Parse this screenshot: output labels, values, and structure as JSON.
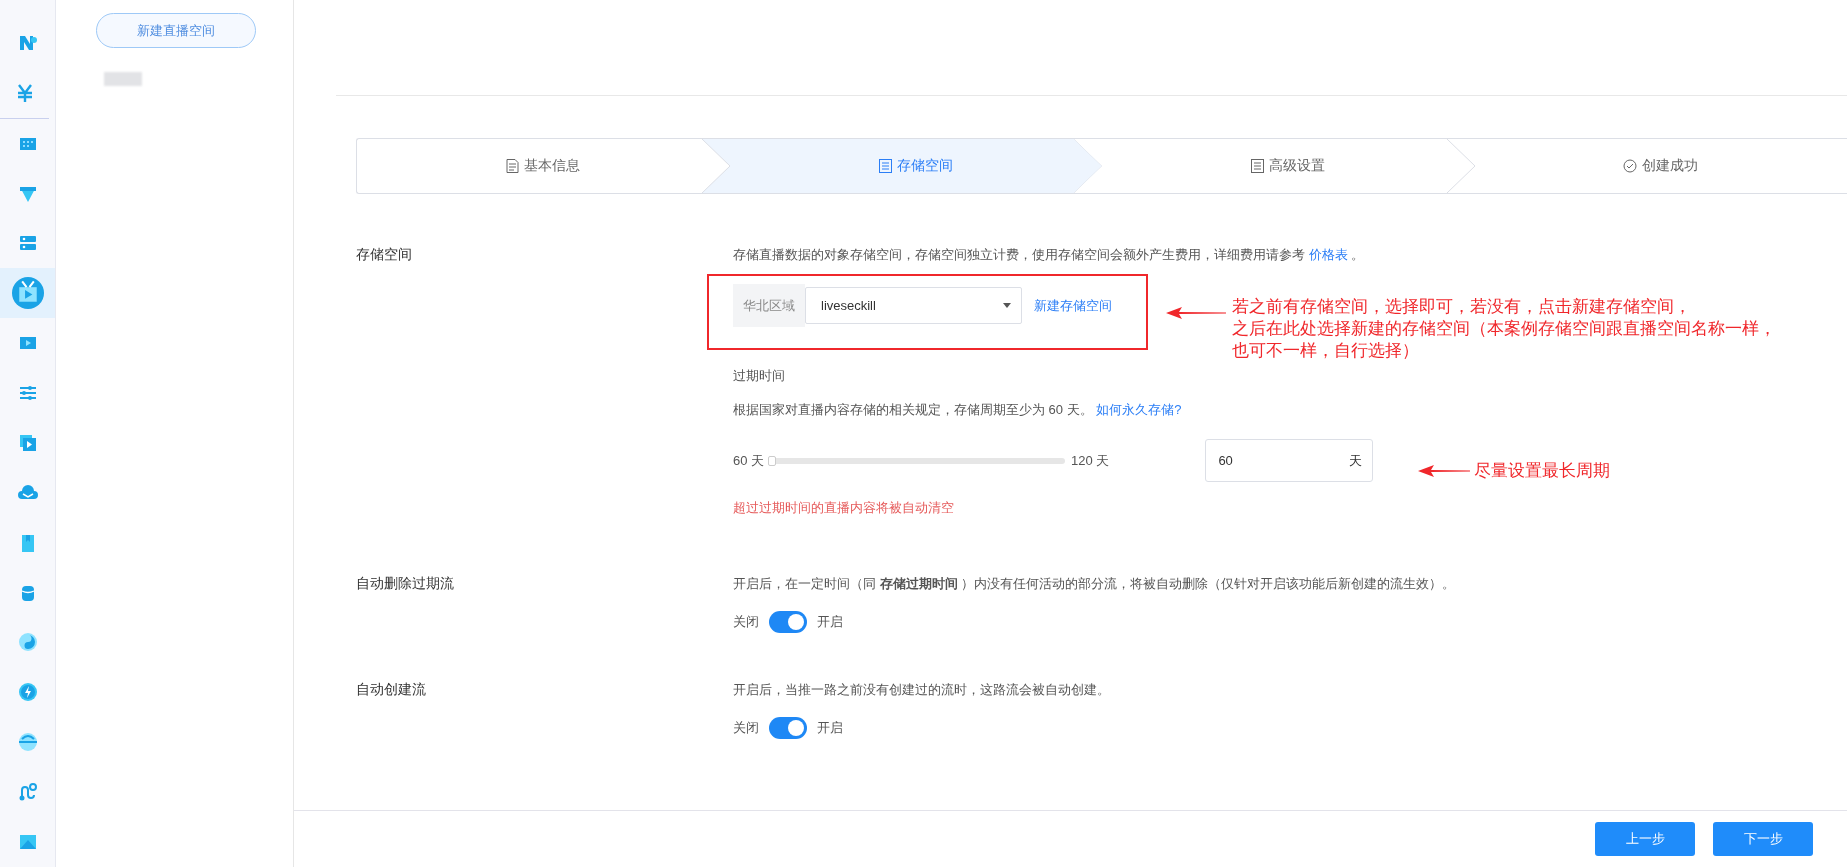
{
  "sidebar": {
    "items": [
      {
        "kind": "logo",
        "selected": false
      },
      {
        "kind": "yen",
        "selected": false
      },
      {
        "kind": "grid",
        "selected": false
      },
      {
        "kind": "funnel",
        "selected": false
      },
      {
        "kind": "server",
        "selected": false
      },
      {
        "kind": "tv",
        "selected": true
      },
      {
        "kind": "film",
        "selected": false
      },
      {
        "kind": "sliders",
        "selected": false
      },
      {
        "kind": "play",
        "selected": false
      },
      {
        "kind": "cloud",
        "selected": false
      },
      {
        "kind": "bookmark",
        "selected": false
      },
      {
        "kind": "database",
        "selected": false
      },
      {
        "kind": "yinyang",
        "selected": false
      },
      {
        "kind": "bolt",
        "selected": false
      },
      {
        "kind": "globe",
        "selected": false
      },
      {
        "kind": "route",
        "selected": false
      },
      {
        "kind": "image",
        "selected": false
      }
    ]
  },
  "space_panel": {
    "new_button": "新建直播空间"
  },
  "steps": [
    {
      "label": "基本信息",
      "kind": "doc",
      "selected": false
    },
    {
      "label": "存储空间",
      "kind": "list",
      "selected": true
    },
    {
      "label": "高级设置",
      "kind": "list",
      "selected": false
    },
    {
      "label": "创建成功",
      "kind": "check",
      "selected": false
    }
  ],
  "storage": {
    "label": "存储空间",
    "description": "存储直播数据的对象存储空间，存储空间独立计费，使用存储空间会额外产生费用，详细费用请参考",
    "price_link": "价格表",
    "description_end": "。",
    "region": "华北区域",
    "bucket": "liveseckill",
    "new_bucket_link": "新建存储空间",
    "expiry_title": "过期时间",
    "expiry_rule": "根据国家对直播内容存储的相关规定，存储周期至少为 60 天。",
    "expiry_link": "如何永久存储?",
    "slider_min": "60 天",
    "slider_max": "120 天",
    "level": 0,
    "days_value": "60",
    "days_unit": "天",
    "expiry_warning": "超过过期时间的直播内容将被自动清空"
  },
  "options": [
    {
      "label": "自动删除过期流",
      "description": "开启后，在一定时间（同 **存储过期时间** ）内没有任何活动的部分流，将被自动删除（仅针对开启该功能后新创建的流生效）。",
      "off_label": "关闭",
      "on_label": "开启",
      "on": true
    },
    {
      "label": "自动创建流",
      "description": "开启后，当推一路之前没有创建过的流时，这路流会被自动创建。",
      "off_label": "关闭",
      "on_label": "开启",
      "on": true
    }
  ],
  "footer": {
    "prev": "上一步",
    "next": "下一步"
  },
  "annotations": [
    {
      "kind": "box-arrow",
      "lines": [
        "若之前有存储空间，选择即可，若没有，点击新建存储空间，",
        "之后在此处选择新建的存储空间（本案例存储空间跟直播空间名称一样，",
        "也可不一样，自行选择）"
      ]
    },
    {
      "kind": "arrow",
      "lines": [
        "尽量设置最长周期"
      ]
    }
  ]
}
